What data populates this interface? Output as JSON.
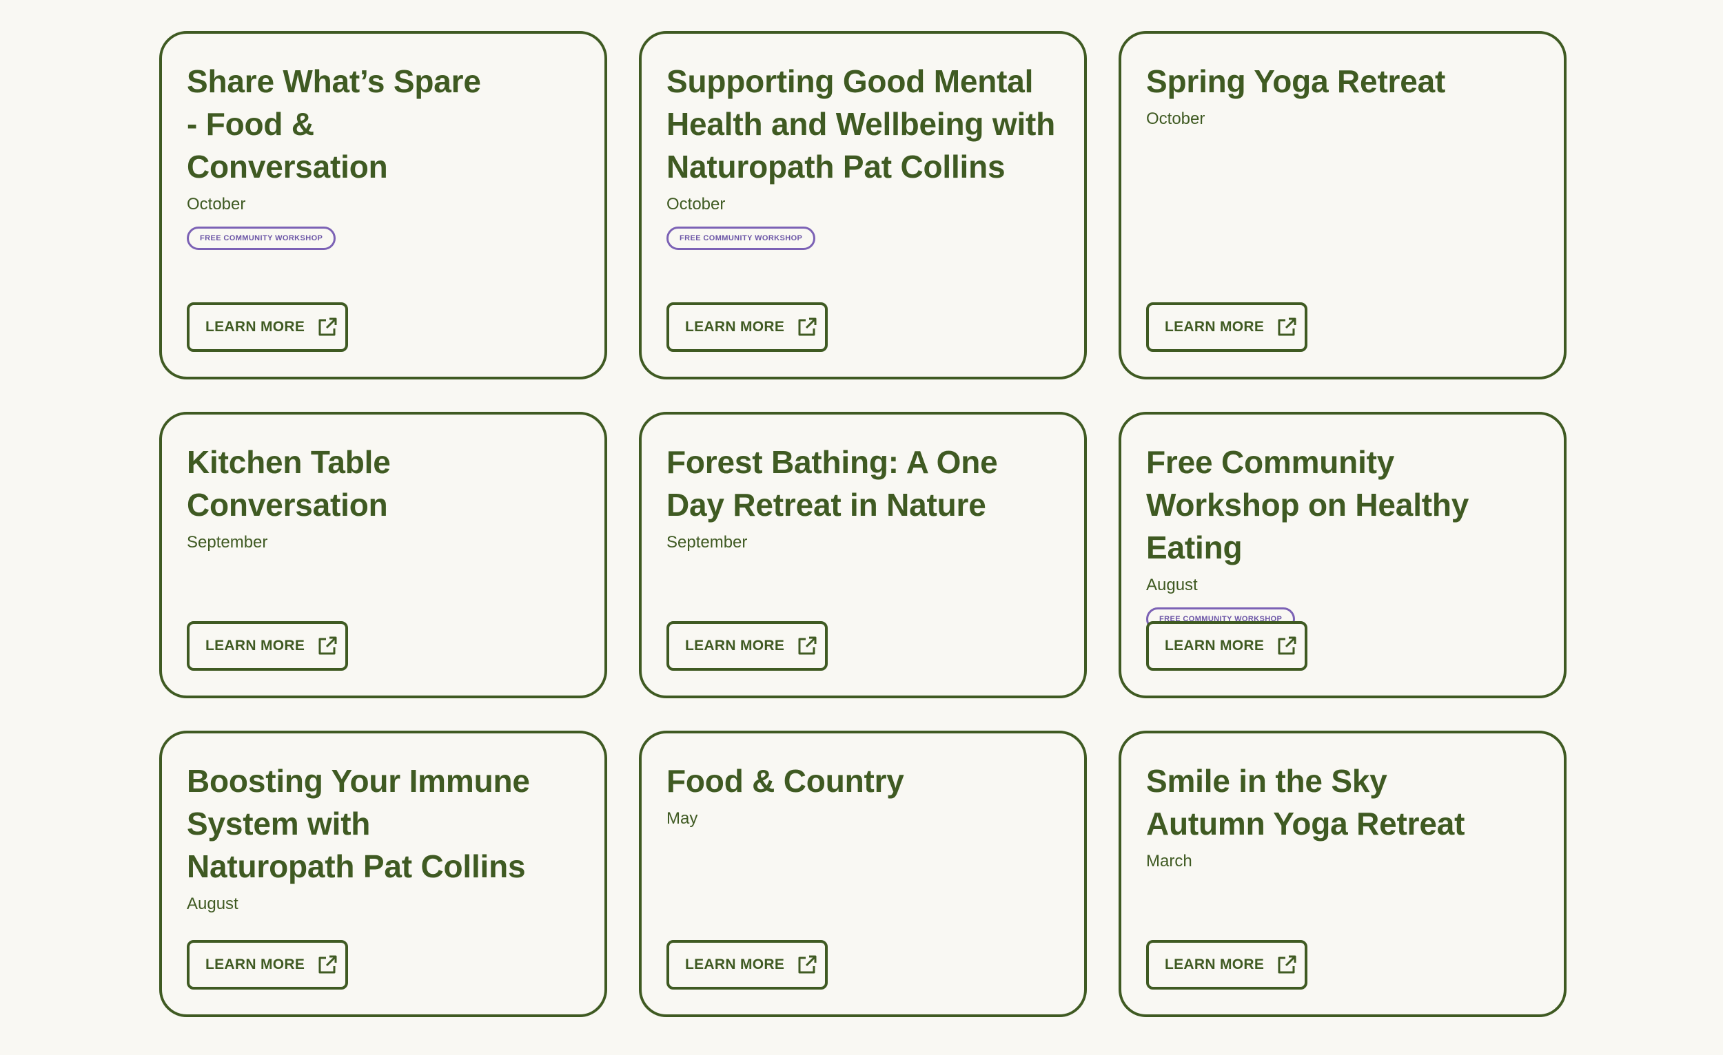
{
  "colors": {
    "background": "#f9f8f3",
    "primary_green": "#3f5a22",
    "badge_purple": "#7c62b5"
  },
  "icons": {
    "button_icon": "external-link-icon"
  },
  "cards": [
    {
      "title": "Share What’s Spare - Food & Conversation",
      "date": "October",
      "badge": "FREE COMMUNITY WORKSHOP",
      "button_label": "LEARN MORE"
    },
    {
      "title": "Supporting Good Mental Health and Wellbeing with Naturopath Pat Collins",
      "date": "October",
      "badge": "FREE COMMUNITY WORKSHOP",
      "button_label": "LEARN MORE"
    },
    {
      "title": "Spring Yoga Retreat",
      "date": "October",
      "button_label": "LEARN MORE"
    },
    {
      "title": "Kitchen Table Conversation",
      "date": "September",
      "button_label": "LEARN MORE"
    },
    {
      "title": "Forest Bathing: A One Day Retreat in Nature",
      "date": "September",
      "button_label": "LEARN MORE"
    },
    {
      "title": "Free Community Workshop on Healthy Eating",
      "date": "August",
      "badge": "FREE COMMUNITY WORKSHOP",
      "button_label": "LEARN MORE"
    },
    {
      "title": "Boosting Your Immune System with Naturopath Pat Collins",
      "date": "August",
      "button_label": "LEARN MORE"
    },
    {
      "title": "Food & Country",
      "date": "May",
      "button_label": "LEARN MORE"
    },
    {
      "title": "Smile in the Sky Autumn Yoga Retreat",
      "date": "March",
      "button_label": "LEARN MORE"
    }
  ]
}
